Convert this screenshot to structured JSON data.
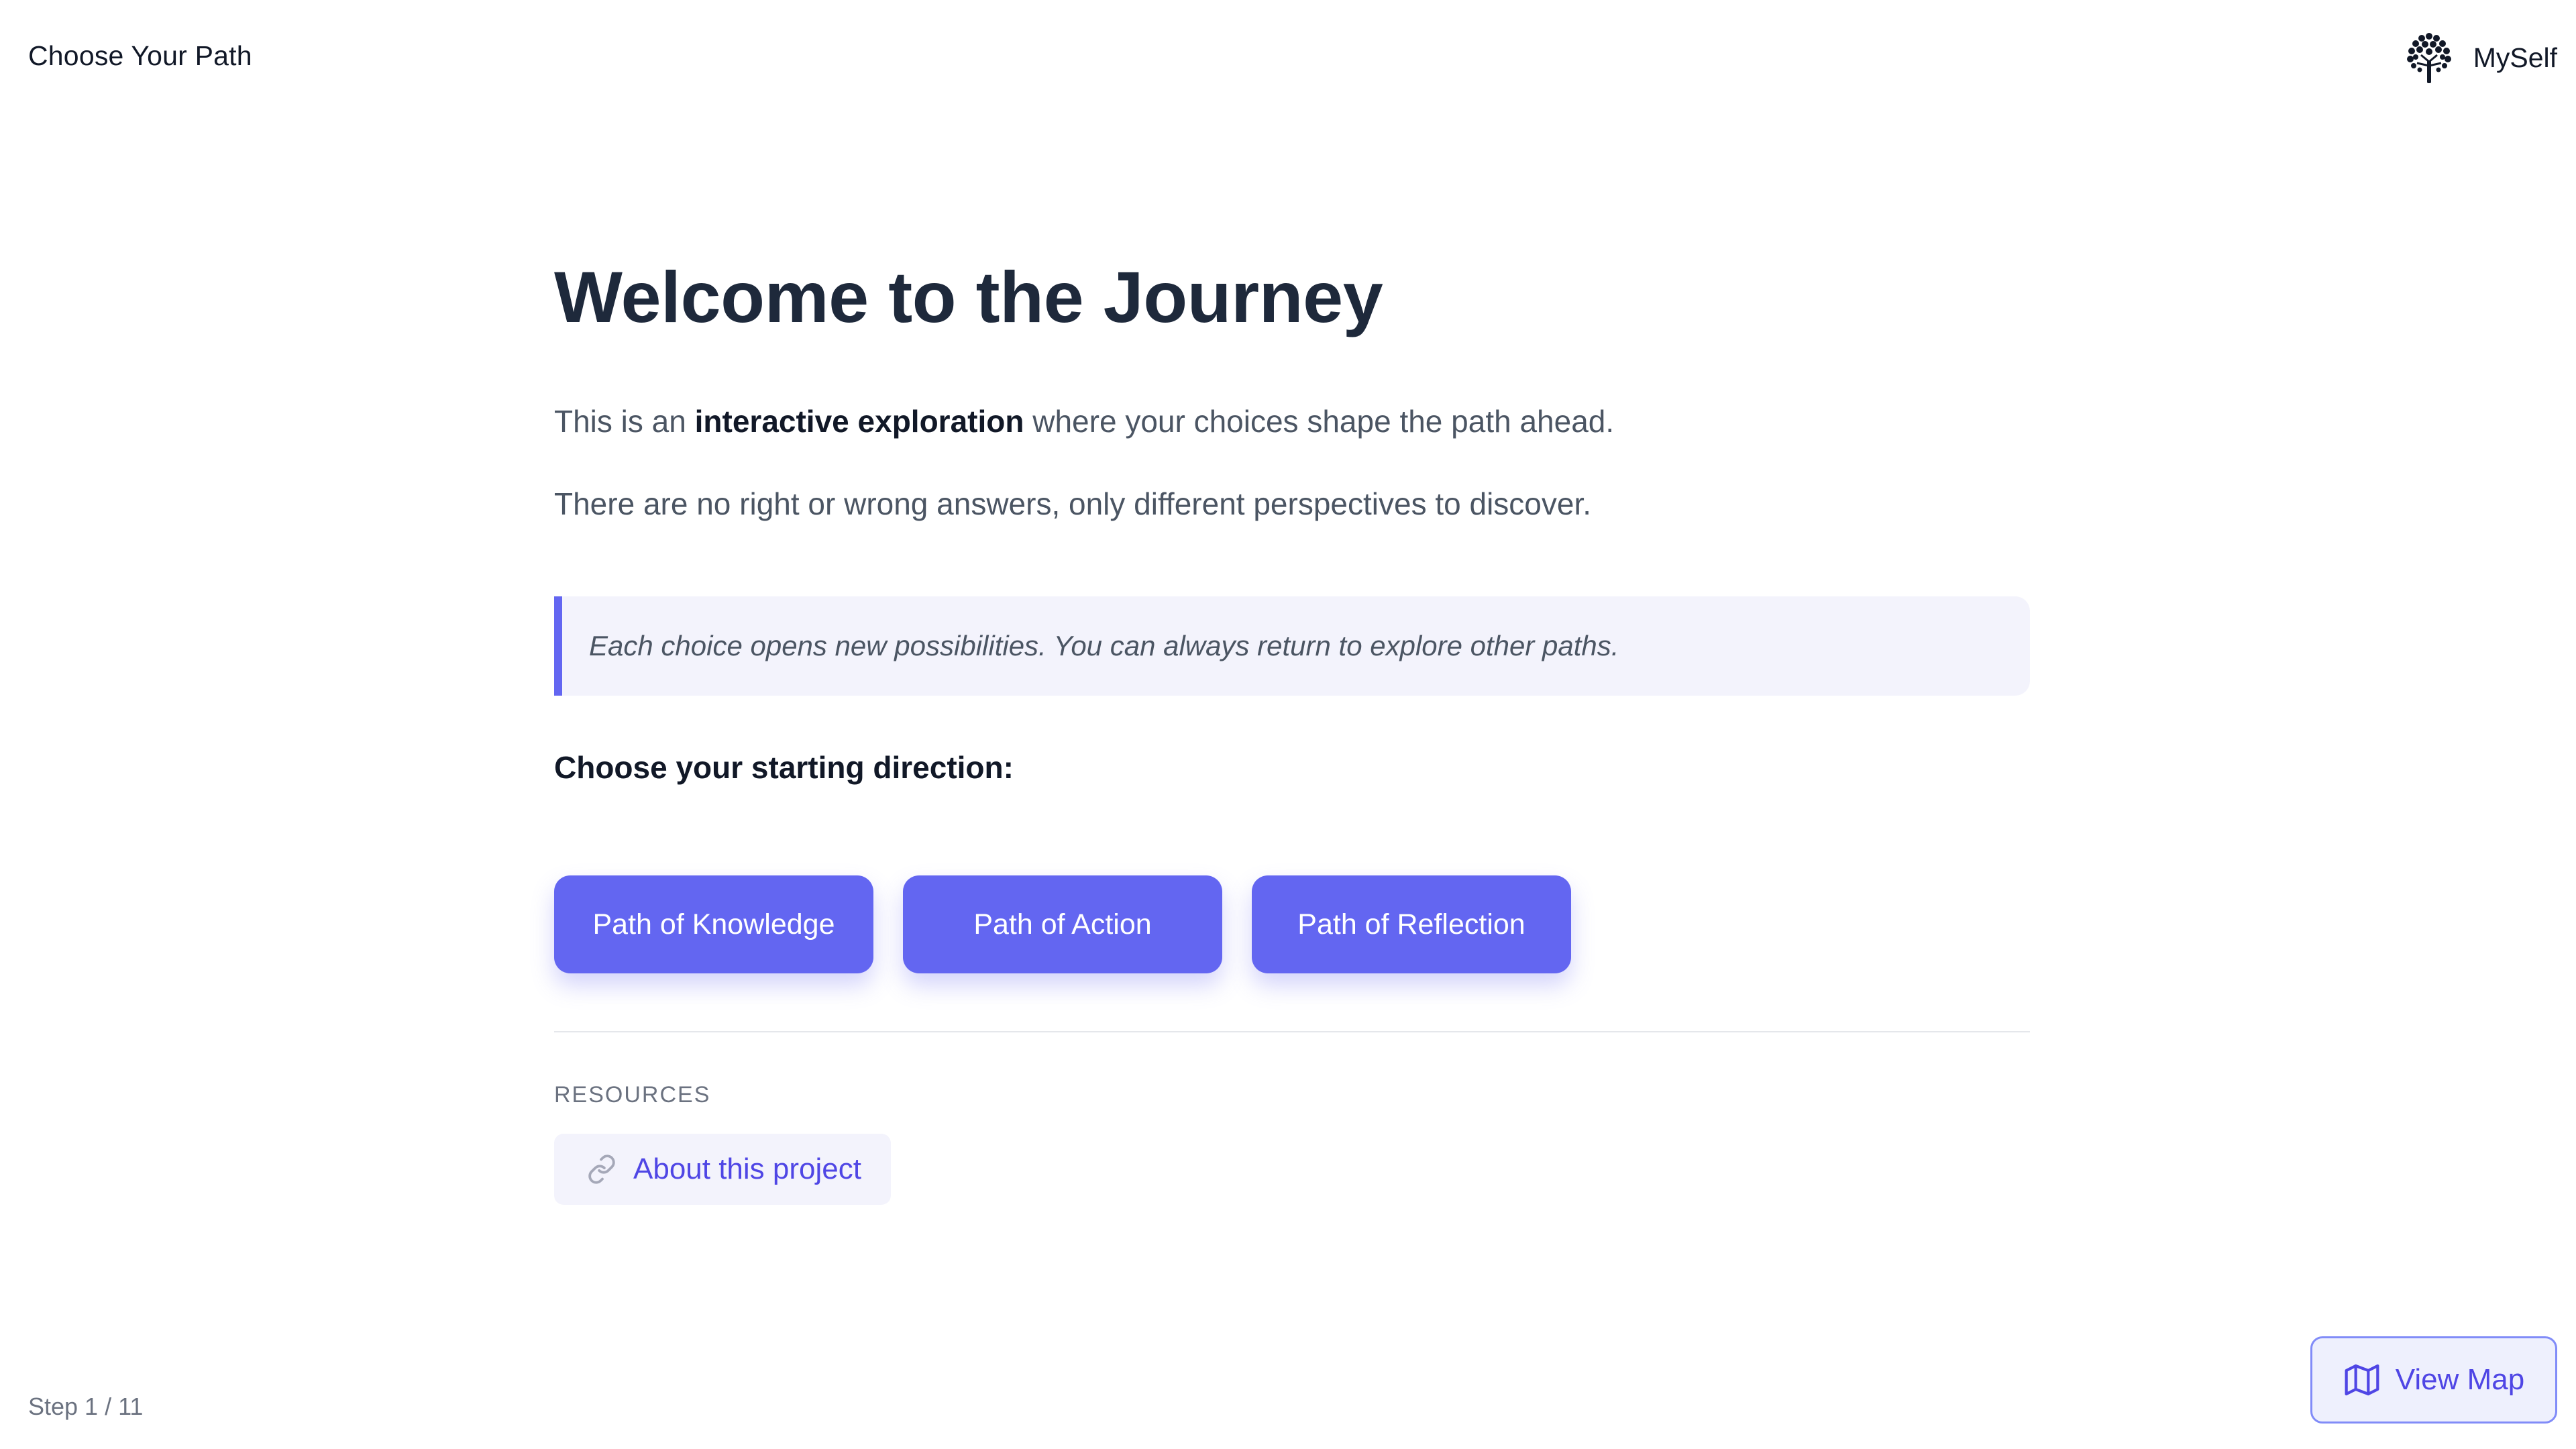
{
  "header": {
    "app_title": "Choose Your Path",
    "brand_name": "MySelf",
    "brand_icon": "tree-icon"
  },
  "main": {
    "title": "Welcome to the Journey",
    "intro_prefix": "This is an ",
    "intro_emphasis": "interactive exploration",
    "intro_suffix": " where your choices shape the path ahead.",
    "intro_2": "There are no right or wrong answers, only different perspectives to discover.",
    "note": "Each choice opens new possibilities. You can always return to explore other paths.",
    "choose_label": "Choose your starting direction:",
    "choices": [
      {
        "label": "Path of Knowledge"
      },
      {
        "label": "Path of Action"
      },
      {
        "label": "Path of Reflection"
      }
    ],
    "resources_label": "RESOURCES",
    "resources": [
      {
        "label": "About this project",
        "icon": "link-icon"
      }
    ]
  },
  "footer": {
    "step_text": "Step 1 / 11",
    "current_step": 1,
    "total_steps": 11,
    "view_map_label": "View Map",
    "view_map_icon": "map-icon"
  },
  "colors": {
    "accent": "#6366f1",
    "accent_text": "#4f46e5",
    "note_background": "#f3f3fc",
    "heading": "#1e293b",
    "body_text": "#4b5563"
  }
}
